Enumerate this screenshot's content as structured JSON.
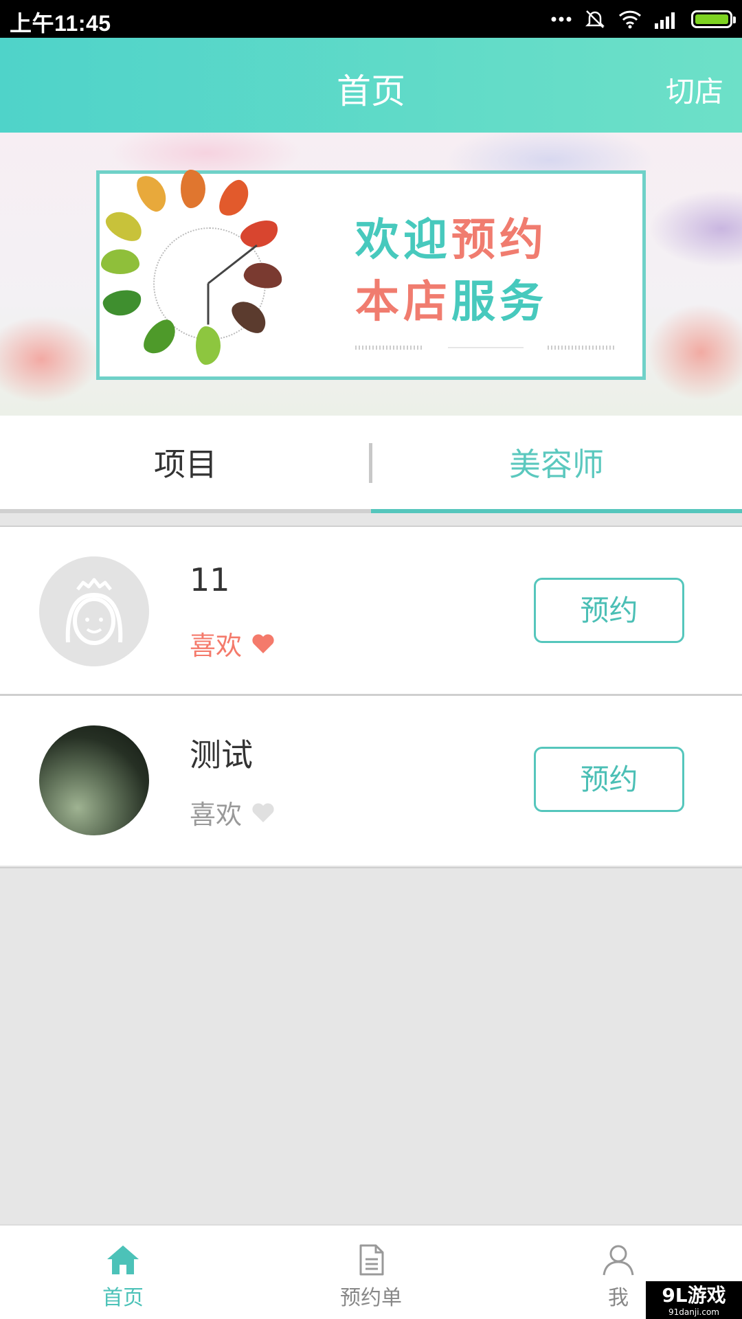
{
  "status_bar": {
    "time": "上午11:45",
    "icons": [
      "more-dots-icon",
      "mute-icon",
      "wifi-icon",
      "signal-icon",
      "battery-icon"
    ]
  },
  "header": {
    "title": "首页",
    "switch_store_label": "切店",
    "color_start": "#4fd3c9",
    "color_end": "#6de0c8"
  },
  "banner": {
    "line1_a": "欢迎",
    "line1_b": "预约",
    "line2_a": "本店",
    "line2_b": "服务"
  },
  "tabs": [
    {
      "label": "项目",
      "active": false
    },
    {
      "label": "美容师",
      "active": true
    }
  ],
  "beauticians": [
    {
      "name": "11",
      "like_label": "喜欢",
      "liked": true,
      "book_label": "预约",
      "avatar": "default-avatar-icon"
    },
    {
      "name": "测试",
      "like_label": "喜欢",
      "liked": false,
      "book_label": "预约",
      "avatar": "photo"
    }
  ],
  "tab_bar": {
    "items": [
      {
        "label": "首页",
        "icon": "home-icon",
        "active": true
      },
      {
        "label": "预约单",
        "icon": "document-icon",
        "active": false
      },
      {
        "label": "我",
        "icon": "user-icon",
        "active": false
      }
    ]
  },
  "watermark": {
    "main": "9L游戏",
    "sub": "91danji.com"
  },
  "colors": {
    "accent": "#55c6bc",
    "like_active": "#f47a6b",
    "like_inactive": "#999999"
  }
}
